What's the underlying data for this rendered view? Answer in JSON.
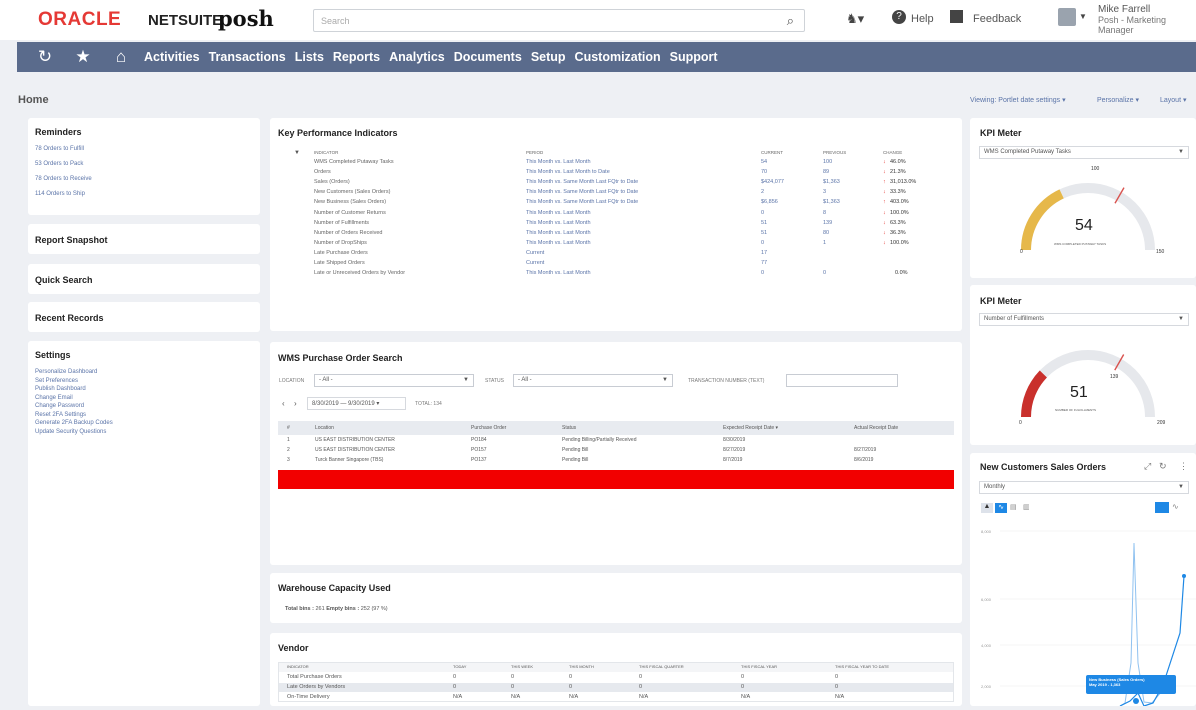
{
  "brand": {
    "oracle": "ORACLE",
    "netsuite": "NETSUITE",
    "company": "posh"
  },
  "search": {
    "placeholder": "Search"
  },
  "topbar": {
    "help": "Help",
    "feedback": "Feedback",
    "user_name": "Mike Farrell",
    "user_role": "Posh - Marketing Manager"
  },
  "nav": {
    "items": [
      "Activities",
      "Transactions",
      "Lists",
      "Reports",
      "Analytics",
      "Documents",
      "Setup",
      "Customization",
      "Support"
    ]
  },
  "page": {
    "title": "Home",
    "viewing": "Viewing: Portlet date settings ▾",
    "personalize": "Personalize ▾",
    "layout": "Layout ▾"
  },
  "reminders": {
    "title": "Reminders",
    "items": [
      "78 Orders to Fulfill",
      "53 Orders to Pack",
      "78 Orders to Receive",
      "114 Orders to Ship"
    ]
  },
  "sidebar": {
    "report_snapshot": "Report Snapshot",
    "quick_search": "Quick Search",
    "recent_records": "Recent Records",
    "settings_title": "Settings",
    "settings": [
      "Personalize Dashboard",
      "Set Preferences",
      "Publish Dashboard",
      "Change Email",
      "Change Password",
      "Reset 2FA Settings",
      "Generate 2FA Backup Codes",
      "Update Security Questions"
    ]
  },
  "kpi": {
    "title": "Key Performance Indicators",
    "headers": [
      "INDICATOR",
      "PERIOD",
      "CURRENT",
      "PREVIOUS",
      "CHANGE"
    ],
    "rows": [
      {
        "indicator": "WMS Completed Putaway Tasks",
        "period": "This Month vs. Last Month",
        "current": "54",
        "previous": "100",
        "change": "46.0%",
        "dir": "down"
      },
      {
        "indicator": "Orders",
        "period": "This Month vs. Last Month to Date",
        "current": "70",
        "previous": "89",
        "change": "21.3%",
        "dir": "down"
      },
      {
        "indicator": "Sales (Orders)",
        "period": "This Month vs. Same Month Last FQtr to Date",
        "current": "$424,077",
        "previous": "$1,363",
        "change": "31,013.0%",
        "dir": "up"
      },
      {
        "indicator": "New Customers (Sales Orders)",
        "period": "This Month vs. Same Month Last FQtr to Date",
        "current": "2",
        "previous": "3",
        "change": "33.3%",
        "dir": "down"
      },
      {
        "indicator": "New Business (Sales Orders)",
        "period": "This Month vs. Same Month Last FQtr to Date",
        "current": "$6,856",
        "previous": "$1,363",
        "change": "403.0%",
        "dir": "up"
      },
      {
        "indicator": "Number of Customer Returns",
        "period": "This Month vs. Last Month",
        "current": "0",
        "previous": "8",
        "change": "100.0%",
        "dir": "down"
      },
      {
        "indicator": "Number of Fulfillments",
        "period": "This Month vs. Last Month",
        "current": "51",
        "previous": "139",
        "change": "63.3%",
        "dir": "down"
      },
      {
        "indicator": "Number of Orders Received",
        "period": "This Month vs. Last Month",
        "current": "51",
        "previous": "80",
        "change": "36.3%",
        "dir": "down"
      },
      {
        "indicator": "Number of DropShips",
        "period": "This Month vs. Last Month",
        "current": "0",
        "previous": "1",
        "change": "100.0%",
        "dir": "down"
      },
      {
        "indicator": "Late Purchase Orders",
        "period": "Current",
        "current": "17",
        "previous": "",
        "change": "",
        "dir": ""
      },
      {
        "indicator": "Late Shipped Orders",
        "period": "Current",
        "current": "77",
        "previous": "",
        "change": "",
        "dir": ""
      },
      {
        "indicator": "Late or Unreceived Orders by Vendor",
        "period": "This Month vs. Last Month",
        "current": "0",
        "previous": "0",
        "change": "0.0%",
        "dir": ""
      }
    ]
  },
  "wms": {
    "title": "WMS Purchase Order Search",
    "location_label": "LOCATION",
    "location_value": "- All -",
    "status_label": "STATUS",
    "status_value": "- All -",
    "txn_label": "TRANSACTION NUMBER (TEXT)",
    "date_range": "8/30/2019 — 9/30/2019 ▾",
    "total": "TOTAL: 134",
    "headers": [
      "#",
      "Location",
      "Purchase Order",
      "Status",
      "Expected Receipt Date ▾",
      "Actual Receipt Date"
    ],
    "rows": [
      {
        "n": "1",
        "loc": "US EAST DISTRIBUTION CENTER",
        "po": "PO184",
        "status": "Pending Billing/Partially Received",
        "exp": "8/30/2019",
        "act": ""
      },
      {
        "n": "2",
        "loc": "US EAST DISTRIBUTION CENTER",
        "po": "PO157",
        "status": "Pending Bill",
        "exp": "8/27/2019",
        "act": "8/27/2019"
      },
      {
        "n": "3",
        "loc": "Turck Banner Singapore (TBS)",
        "po": "PO137",
        "status": "Pending Bill",
        "exp": "8/7/2019",
        "act": "8/6/2019"
      }
    ]
  },
  "warehouse": {
    "title": "Warehouse Capacity Used",
    "total_label": "Total bins :",
    "total_value": "261",
    "empty_label": "Empty bins :",
    "empty_value": "252 (97 %)"
  },
  "vendor": {
    "title": "Vendor",
    "headers": [
      "INDICATOR",
      "TODAY",
      "THIS WEEK",
      "THIS MONTH",
      "THIS FISCAL QUARTER",
      "THIS FISCAL YEAR",
      "THIS FISCAL YEAR TO DATE"
    ],
    "rows": [
      [
        "Total Purchase Orders",
        "0",
        "0",
        "0",
        "0",
        "0",
        "0"
      ],
      [
        "Late Orders by Vendors",
        "0",
        "0",
        "0",
        "0",
        "0",
        "0"
      ],
      [
        "On-Time Delivery",
        "N/A",
        "N/A",
        "N/A",
        "N/A",
        "N/A",
        "N/A"
      ]
    ]
  },
  "kpi_meter1": {
    "title": "KPI Meter",
    "select": "WMS Completed Putaway Tasks",
    "value": "54",
    "label": "WMS COMPLETED PUTAWAY TASKS",
    "min": "0",
    "max": "150",
    "target": "100",
    "fraction": 0.36,
    "color": "#e6b84a"
  },
  "kpi_meter2": {
    "title": "KPI Meter",
    "select": "Number of Fulfillments",
    "value": "51",
    "label": "NUMBER OF FULFILLMENTS",
    "min": "0",
    "max": "209",
    "target": "139",
    "fraction": 0.244,
    "color": "#c9302c"
  },
  "new_customers": {
    "title": "New Customers Sales Orders",
    "period": "Monthly",
    "tooltip_line1": "New Business (Sales Orders)",
    "tooltip_line2": "May 2019 - 1,363",
    "y_ticks": [
      "8,000",
      "6,000",
      "4,000",
      "2,000"
    ]
  }
}
